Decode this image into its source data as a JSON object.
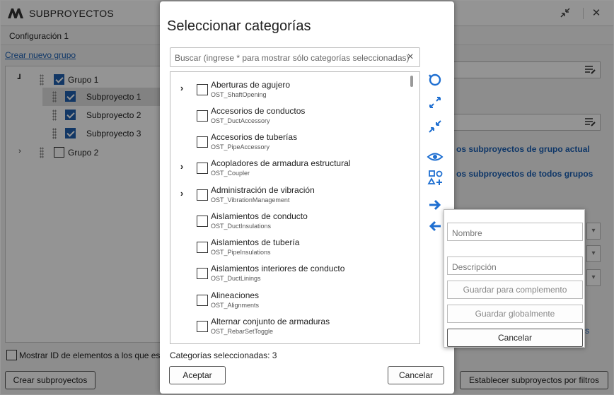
{
  "app": {
    "title": "SUBPROYECTOS",
    "config_label": "Configuración 1",
    "new_group_link": "Crear nuevo grupo",
    "tree": [
      {
        "label": "Grupo 1",
        "checked": true,
        "expanded": true
      },
      {
        "label": "Subproyecto 1",
        "checked": true
      },
      {
        "label": "Subproyecto 2",
        "checked": true
      },
      {
        "label": "Subproyecto 3",
        "checked": true
      },
      {
        "label": "Grupo 2",
        "checked": false,
        "expanded": false
      }
    ],
    "right_links": {
      "current_group": "os subproyectos de grupo actual",
      "all_groups": "os subproyectos de todos grupos",
      "bottom_right": "s"
    },
    "show_ids_label": "Mostrar ID de elementos a los que est",
    "create_button": "Crear subproyectos",
    "filters_button": "Establecer subproyectos por filtros"
  },
  "dialog": {
    "title": "Seleccionar categorías",
    "search_placeholder": "Buscar (ingrese * para mostrar sólo categorías seleccionadas)",
    "clear_icon": "×",
    "categories": [
      {
        "name": "Aberturas de agujero",
        "code": "OST_ShaftOpening",
        "expandable": true
      },
      {
        "name": "Accesorios de conductos",
        "code": "OST_DuctAccessory",
        "expandable": false
      },
      {
        "name": "Accesorios de tuberías",
        "code": "OST_PipeAccessory",
        "expandable": false
      },
      {
        "name": "Acopladores de armadura estructural",
        "code": "OST_Coupler",
        "expandable": true
      },
      {
        "name": "Administración de vibración",
        "code": "OST_VibrationManagement",
        "expandable": true
      },
      {
        "name": "Aislamientos de conducto",
        "code": "OST_DuctInsulations",
        "expandable": false
      },
      {
        "name": "Aislamientos de tubería",
        "code": "OST_PipeInsulations",
        "expandable": false
      },
      {
        "name": "Aislamientos interiores de conducto",
        "code": "OST_DuctLinings",
        "expandable": false
      },
      {
        "name": "Alineaciones",
        "code": "OST_Alignments",
        "expandable": false
      },
      {
        "name": "Alternar conjunto de armaduras",
        "code": "OST_RebarSetToggle",
        "expandable": false
      }
    ],
    "selected_count_label": "Categorías seleccionadas: 3",
    "accept_button": "Aceptar",
    "cancel_button": "Cancelar",
    "tools": [
      "refresh-icon",
      "expand-icon",
      "collapse-icon",
      "eye-icon",
      "shapes-add-icon",
      "arrow-right-icon",
      "arrow-left-icon"
    ],
    "accent": "#1f6fd1"
  },
  "popup": {
    "name_placeholder": "Nombre",
    "description_placeholder": "Descripción",
    "save_complement_button": "Guardar para complemento",
    "save_global_button": "Guardar globalmente",
    "cancel_button": "Cancelar"
  }
}
